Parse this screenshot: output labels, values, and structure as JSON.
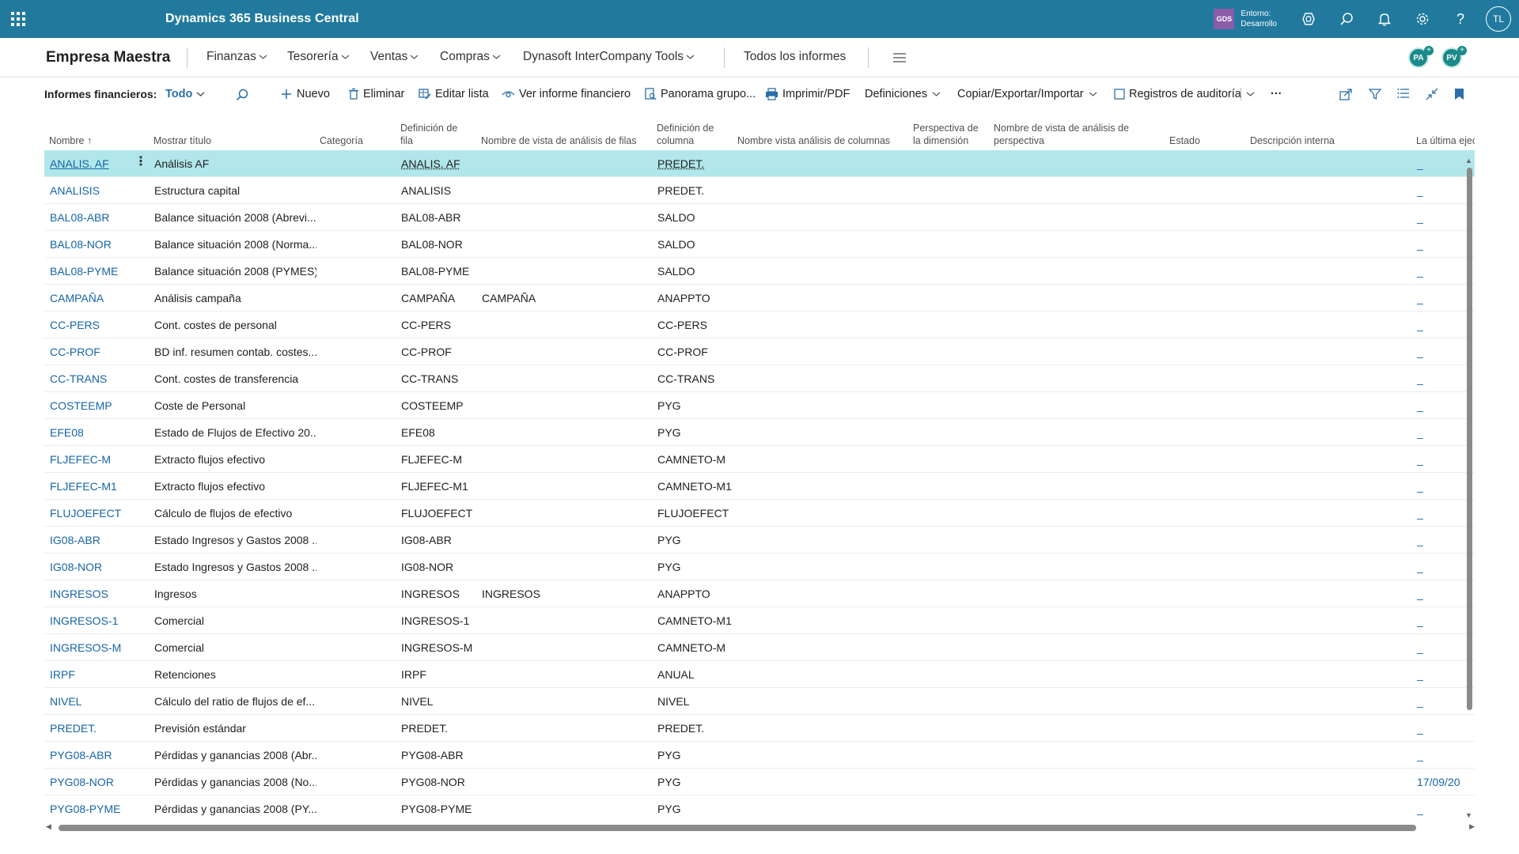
{
  "appbar": {
    "title": "Dynamics 365 Business Central",
    "env_badge": "GDS",
    "env_label": "Entorno:",
    "env_value": "Desarrollo",
    "avatar": "TL"
  },
  "nav": {
    "company": "Empresa Maestra",
    "items": [
      "Finanzas",
      "Tesorería",
      "Ventas",
      "Compras",
      "Dynasoft InterCompany Tools"
    ],
    "all_reports": "Todos los informes",
    "personas": [
      "PA",
      "PV"
    ]
  },
  "actions": {
    "label": "Informes financieros:",
    "filter": "Todo",
    "new": "Nuevo",
    "delete": "Eliminar",
    "edit_list": "Editar lista",
    "view_report": "Ver informe financiero",
    "group_overview": "Panorama grupo...",
    "print": "Imprimir/PDF",
    "definitions": "Definiciones",
    "copy_export": "Copiar/Exportar/Importar",
    "audit_logs": "Registros de auditoría",
    "more": "···"
  },
  "columns": {
    "name": "Nombre",
    "title": "Mostrar título",
    "category": "Categoría",
    "row_def_1": "Definición de",
    "row_def_2": "fila",
    "row_view": "Nombre de vista de análisis de filas",
    "col_def_1": "Definición de",
    "col_def_2": "columna",
    "col_view": "Nombre vista análisis de columnas",
    "dim_persp_1": "Perspectiva de",
    "dim_persp_2": "la dimensión",
    "persp_view_1": "Nombre de vista de análisis de",
    "persp_view_2": "perspectiva",
    "status": "Estado",
    "internal_desc": "Descripción interna",
    "last_exec": "La última ejec"
  },
  "rows": [
    {
      "name": "ANALIS. AF",
      "title": "Análisis AF",
      "row_def": "ANALIS. AF",
      "row_view": "",
      "col_def": "PREDET.",
      "last": "_"
    },
    {
      "name": "ANALISIS",
      "title": "Estructura capital",
      "row_def": "ANALISIS",
      "row_view": "",
      "col_def": "PREDET.",
      "last": "_"
    },
    {
      "name": "BAL08-ABR",
      "title": "Balance situación  2008 (Abrevi...",
      "row_def": "BAL08-ABR",
      "row_view": "",
      "col_def": "SALDO",
      "last": "_"
    },
    {
      "name": "BAL08-NOR",
      "title": "Balance situación 2008 (Norma...",
      "row_def": "BAL08-NOR",
      "row_view": "",
      "col_def": "SALDO",
      "last": "_"
    },
    {
      "name": "BAL08-PYME",
      "title": "Balance situación 2008 (PYMES)",
      "row_def": "BAL08-PYME",
      "row_view": "",
      "col_def": "SALDO",
      "last": "_"
    },
    {
      "name": "CAMPAÑA",
      "title": "Análisis campaña",
      "row_def": "CAMPAÑA",
      "row_view": "CAMPAÑA",
      "col_def": "ANAPPTO",
      "last": "_"
    },
    {
      "name": "CC-PERS",
      "title": "Cont. costes de personal",
      "row_def": "CC-PERS",
      "row_view": "",
      "col_def": "CC-PERS",
      "last": "_"
    },
    {
      "name": "CC-PROF",
      "title": "BD inf. resumen contab. costes...",
      "row_def": "CC-PROF",
      "row_view": "",
      "col_def": "CC-PROF",
      "last": "_"
    },
    {
      "name": "CC-TRANS",
      "title": "Cont. costes de transferencia",
      "row_def": "CC-TRANS",
      "row_view": "",
      "col_def": "CC-TRANS",
      "last": "_"
    },
    {
      "name": "COSTEEMP",
      "title": "Coste de Personal",
      "row_def": "COSTEEMP",
      "row_view": "",
      "col_def": "PYG",
      "last": "_"
    },
    {
      "name": "EFE08",
      "title": "Estado de Flujos de Efectivo 20...",
      "row_def": "EFE08",
      "row_view": "",
      "col_def": "PYG",
      "last": "_"
    },
    {
      "name": "FLJEFEC-M",
      "title": "Extracto flujos efectivo",
      "row_def": "FLJEFEC-M",
      "row_view": "",
      "col_def": "CAMNETO-M",
      "last": "_"
    },
    {
      "name": "FLJEFEC-M1",
      "title": "Extracto flujos efectivo",
      "row_def": "FLJEFEC-M1",
      "row_view": "",
      "col_def": "CAMNETO-M1",
      "last": "_"
    },
    {
      "name": "FLUJOEFECT",
      "title": "Cálculo de flujos de efectivo",
      "row_def": "FLUJOEFECT",
      "row_view": "",
      "col_def": "FLUJOEFECT",
      "last": "_"
    },
    {
      "name": "IG08-ABR",
      "title": "Estado Ingresos y Gastos 2008 ...",
      "row_def": "IG08-ABR",
      "row_view": "",
      "col_def": "PYG",
      "last": "_"
    },
    {
      "name": "IG08-NOR",
      "title": "Estado Ingresos y Gastos 2008 ...",
      "row_def": "IG08-NOR",
      "row_view": "",
      "col_def": "PYG",
      "last": "_"
    },
    {
      "name": "INGRESOS",
      "title": "Ingresos",
      "row_def": "INGRESOS",
      "row_view": "INGRESOS",
      "col_def": "ANAPPTO",
      "last": "_"
    },
    {
      "name": "INGRESOS-1",
      "title": "Comercial",
      "row_def": "INGRESOS-1",
      "row_view": "",
      "col_def": "CAMNETO-M1",
      "last": "_"
    },
    {
      "name": "INGRESOS-M",
      "title": "Comercial",
      "row_def": "INGRESOS-M",
      "row_view": "",
      "col_def": "CAMNETO-M",
      "last": "_"
    },
    {
      "name": "IRPF",
      "title": "Retenciones",
      "row_def": "IRPF",
      "row_view": "",
      "col_def": "ANUAL",
      "last": "_"
    },
    {
      "name": "NIVEL",
      "title": "Cálculo del ratio de flujos de ef...",
      "row_def": "NIVEL",
      "row_view": "",
      "col_def": "NIVEL",
      "last": "_"
    },
    {
      "name": "PREDET.",
      "title": "Previsión estándar",
      "row_def": "PREDET.",
      "row_view": "",
      "col_def": "PREDET.",
      "last": "_"
    },
    {
      "name": "PYG08-ABR",
      "title": "Pérdidas y ganancias 2008 (Abr...",
      "row_def": "PYG08-ABR",
      "row_view": "",
      "col_def": "PYG",
      "last": "_"
    },
    {
      "name": "PYG08-NOR",
      "title": "Pérdidas y ganancias 2008 (No...",
      "row_def": "PYG08-NOR",
      "row_view": "",
      "col_def": "PYG",
      "last": "17/09/20"
    },
    {
      "name": "PYG08-PYME",
      "title": "Pérdidas y ganancias 2008 (PY...",
      "row_def": "PYG08-PYME",
      "row_view": "",
      "col_def": "PYG",
      "last": "_"
    }
  ],
  "colors": {
    "appbar": "#217a9e",
    "link": "#1565a8",
    "selected_row": "#b1e7ea",
    "persona": "#1b8a8a",
    "env_badge": "#8b5ca8"
  }
}
